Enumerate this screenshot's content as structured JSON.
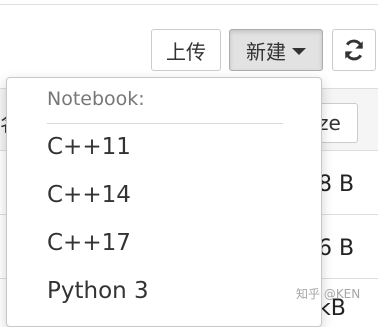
{
  "toolbar": {
    "upload_label": "上传",
    "new_label": "新建",
    "refresh_icon": "refresh-icon"
  },
  "file_list": {
    "name_header_fragment": "名",
    "size_header_fragment": "ze",
    "rows": [
      {
        "size_fragment": "8 B"
      },
      {
        "size_fragment": "6 B"
      },
      {
        "size_fragment": "kB"
      }
    ]
  },
  "new_menu": {
    "section_header": "Notebook:",
    "items": [
      "C++11",
      "C++14",
      "C++17",
      "Python 3"
    ]
  },
  "watermark": "知乎 @KEN",
  "colors": {
    "active_button_bg": "#e2e2e2",
    "border": "#cccccc",
    "header_text": "#777777"
  }
}
